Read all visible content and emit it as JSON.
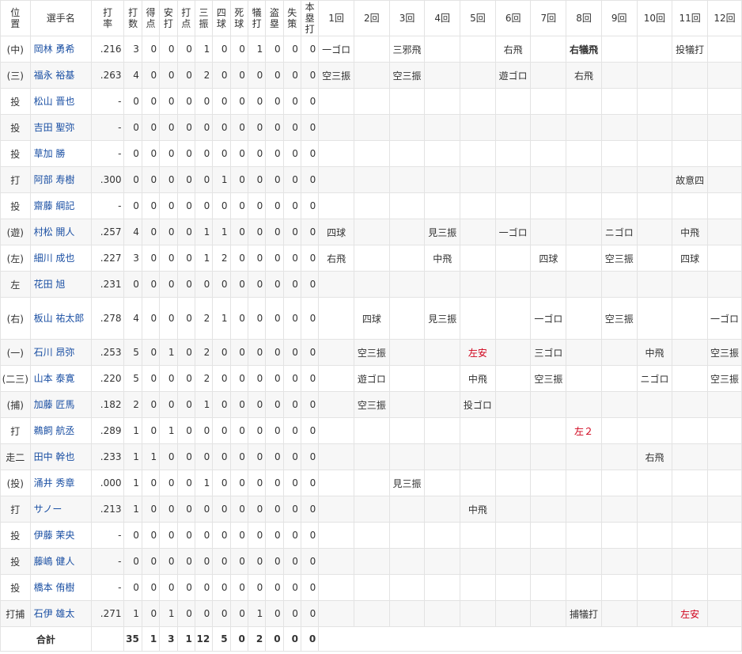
{
  "headers": {
    "pos": "位置",
    "name": "選手名",
    "avg": "打率",
    "ab": "打数",
    "r": "得点",
    "h": "安打",
    "rbi": "打点",
    "so": "三振",
    "bb": "四球",
    "hbp": "死球",
    "sac": "犠打",
    "sb": "盗塁",
    "e": "失策",
    "hr": "本塁打",
    "innings": [
      "1回",
      "2回",
      "3回",
      "4回",
      "5回",
      "6回",
      "7回",
      "8回",
      "9回",
      "10回",
      "11回",
      "12回"
    ]
  },
  "players": [
    {
      "pos": "(中)",
      "name": "岡林 勇希",
      "avg": ".216",
      "ab": "3",
      "r": "0",
      "h": "0",
      "rbi": "0",
      "so": "1",
      "bb": "0",
      "hbp": "0",
      "sac": "1",
      "sb": "0",
      "e": "0",
      "hr": "0",
      "inn": [
        "一ゴロ",
        "",
        "三邪飛",
        "",
        "",
        "右飛",
        "",
        "右犠飛",
        "",
        "",
        "投犠打",
        ""
      ],
      "red": [],
      "bold": [
        7
      ]
    },
    {
      "pos": "(三)",
      "name": "福永 裕基",
      "avg": ".263",
      "ab": "4",
      "r": "0",
      "h": "0",
      "rbi": "0",
      "so": "2",
      "bb": "0",
      "hbp": "0",
      "sac": "0",
      "sb": "0",
      "e": "0",
      "hr": "0",
      "inn": [
        "空三振",
        "",
        "空三振",
        "",
        "",
        "遊ゴロ",
        "",
        "右飛",
        "",
        "",
        "",
        ""
      ],
      "red": [],
      "bold": []
    },
    {
      "pos": "投",
      "name": "松山 晋也",
      "avg": "-",
      "ab": "0",
      "r": "0",
      "h": "0",
      "rbi": "0",
      "so": "0",
      "bb": "0",
      "hbp": "0",
      "sac": "0",
      "sb": "0",
      "e": "0",
      "hr": "0",
      "inn": [
        "",
        "",
        "",
        "",
        "",
        "",
        "",
        "",
        "",
        "",
        "",
        ""
      ],
      "red": [],
      "bold": []
    },
    {
      "pos": "投",
      "name": "吉田 聖弥",
      "avg": "-",
      "ab": "0",
      "r": "0",
      "h": "0",
      "rbi": "0",
      "so": "0",
      "bb": "0",
      "hbp": "0",
      "sac": "0",
      "sb": "0",
      "e": "0",
      "hr": "0",
      "inn": [
        "",
        "",
        "",
        "",
        "",
        "",
        "",
        "",
        "",
        "",
        "",
        ""
      ],
      "red": [],
      "bold": []
    },
    {
      "pos": "投",
      "name": "草加 勝",
      "avg": "-",
      "ab": "0",
      "r": "0",
      "h": "0",
      "rbi": "0",
      "so": "0",
      "bb": "0",
      "hbp": "0",
      "sac": "0",
      "sb": "0",
      "e": "0",
      "hr": "0",
      "inn": [
        "",
        "",
        "",
        "",
        "",
        "",
        "",
        "",
        "",
        "",
        "",
        ""
      ],
      "red": [],
      "bold": []
    },
    {
      "pos": "打",
      "name": "阿部 寿樹",
      "avg": ".300",
      "ab": "0",
      "r": "0",
      "h": "0",
      "rbi": "0",
      "so": "0",
      "bb": "1",
      "hbp": "0",
      "sac": "0",
      "sb": "0",
      "e": "0",
      "hr": "0",
      "inn": [
        "",
        "",
        "",
        "",
        "",
        "",
        "",
        "",
        "",
        "",
        "故意四",
        ""
      ],
      "red": [],
      "bold": []
    },
    {
      "pos": "投",
      "name": "齋藤 綱記",
      "avg": "-",
      "ab": "0",
      "r": "0",
      "h": "0",
      "rbi": "0",
      "so": "0",
      "bb": "0",
      "hbp": "0",
      "sac": "0",
      "sb": "0",
      "e": "0",
      "hr": "0",
      "inn": [
        "",
        "",
        "",
        "",
        "",
        "",
        "",
        "",
        "",
        "",
        "",
        ""
      ],
      "red": [],
      "bold": []
    },
    {
      "pos": "(遊)",
      "name": "村松 開人",
      "avg": ".257",
      "ab": "4",
      "r": "0",
      "h": "0",
      "rbi": "0",
      "so": "1",
      "bb": "1",
      "hbp": "0",
      "sac": "0",
      "sb": "0",
      "e": "0",
      "hr": "0",
      "inn": [
        "四球",
        "",
        "",
        "見三振",
        "",
        "一ゴロ",
        "",
        "",
        "ニゴロ",
        "",
        "中飛",
        ""
      ],
      "red": [],
      "bold": []
    },
    {
      "pos": "(左)",
      "name": "細川 成也",
      "avg": ".227",
      "ab": "3",
      "r": "0",
      "h": "0",
      "rbi": "0",
      "so": "1",
      "bb": "2",
      "hbp": "0",
      "sac": "0",
      "sb": "0",
      "e": "0",
      "hr": "0",
      "inn": [
        "右飛",
        "",
        "",
        "中飛",
        "",
        "",
        "四球",
        "",
        "空三振",
        "",
        "四球",
        ""
      ],
      "red": [],
      "bold": []
    },
    {
      "pos": "左",
      "name": "花田 旭",
      "avg": ".231",
      "ab": "0",
      "r": "0",
      "h": "0",
      "rbi": "0",
      "so": "0",
      "bb": "0",
      "hbp": "0",
      "sac": "0",
      "sb": "0",
      "e": "0",
      "hr": "0",
      "inn": [
        "",
        "",
        "",
        "",
        "",
        "",
        "",
        "",
        "",
        "",
        "",
        ""
      ],
      "red": [],
      "bold": []
    },
    {
      "pos": "(右)",
      "name": "板山 祐太郎",
      "avg": ".278",
      "ab": "4",
      "r": "0",
      "h": "0",
      "rbi": "0",
      "so": "2",
      "bb": "1",
      "hbp": "0",
      "sac": "0",
      "sb": "0",
      "e": "0",
      "hr": "0",
      "inn": [
        "",
        "四球",
        "",
        "見三振",
        "",
        "",
        "一ゴロ",
        "",
        "空三振",
        "",
        "",
        "一ゴロ"
      ],
      "red": [],
      "bold": [],
      "tall": true
    },
    {
      "pos": "(一)",
      "name": "石川 昂弥",
      "avg": ".253",
      "ab": "5",
      "r": "0",
      "h": "1",
      "rbi": "0",
      "so": "2",
      "bb": "0",
      "hbp": "0",
      "sac": "0",
      "sb": "0",
      "e": "0",
      "hr": "0",
      "inn": [
        "",
        "空三振",
        "",
        "",
        "左安",
        "",
        "三ゴロ",
        "",
        "",
        "中飛",
        "",
        "空三振"
      ],
      "red": [
        4
      ],
      "bold": []
    },
    {
      "pos": "(二三)",
      "name": "山本 泰寛",
      "avg": ".220",
      "ab": "5",
      "r": "0",
      "h": "0",
      "rbi": "0",
      "so": "2",
      "bb": "0",
      "hbp": "0",
      "sac": "0",
      "sb": "0",
      "e": "0",
      "hr": "0",
      "inn": [
        "",
        "遊ゴロ",
        "",
        "",
        "中飛",
        "",
        "空三振",
        "",
        "",
        "ニゴロ",
        "",
        "空三振"
      ],
      "red": [],
      "bold": []
    },
    {
      "pos": "(捕)",
      "name": "加藤 匠馬",
      "avg": ".182",
      "ab": "2",
      "r": "0",
      "h": "0",
      "rbi": "0",
      "so": "1",
      "bb": "0",
      "hbp": "0",
      "sac": "0",
      "sb": "0",
      "e": "0",
      "hr": "0",
      "inn": [
        "",
        "空三振",
        "",
        "",
        "投ゴロ",
        "",
        "",
        "",
        "",
        "",
        "",
        ""
      ],
      "red": [],
      "bold": []
    },
    {
      "pos": "打",
      "name": "鵜飼 航丞",
      "avg": ".289",
      "ab": "1",
      "r": "0",
      "h": "1",
      "rbi": "0",
      "so": "0",
      "bb": "0",
      "hbp": "0",
      "sac": "0",
      "sb": "0",
      "e": "0",
      "hr": "0",
      "inn": [
        "",
        "",
        "",
        "",
        "",
        "",
        "",
        "左２",
        "",
        "",
        "",
        ""
      ],
      "red": [
        7
      ],
      "bold": []
    },
    {
      "pos": "走二",
      "name": "田中 幹也",
      "avg": ".233",
      "ab": "1",
      "r": "1",
      "h": "0",
      "rbi": "0",
      "so": "0",
      "bb": "0",
      "hbp": "0",
      "sac": "0",
      "sb": "0",
      "e": "0",
      "hr": "0",
      "inn": [
        "",
        "",
        "",
        "",
        "",
        "",
        "",
        "",
        "",
        "右飛",
        "",
        ""
      ],
      "red": [],
      "bold": []
    },
    {
      "pos": "(投)",
      "name": "涌井 秀章",
      "avg": ".000",
      "ab": "1",
      "r": "0",
      "h": "0",
      "rbi": "0",
      "so": "1",
      "bb": "0",
      "hbp": "0",
      "sac": "0",
      "sb": "0",
      "e": "0",
      "hr": "0",
      "inn": [
        "",
        "",
        "見三振",
        "",
        "",
        "",
        "",
        "",
        "",
        "",
        "",
        ""
      ],
      "red": [],
      "bold": []
    },
    {
      "pos": "打",
      "name": "サノー",
      "avg": ".213",
      "ab": "1",
      "r": "0",
      "h": "0",
      "rbi": "0",
      "so": "0",
      "bb": "0",
      "hbp": "0",
      "sac": "0",
      "sb": "0",
      "e": "0",
      "hr": "0",
      "inn": [
        "",
        "",
        "",
        "",
        "中飛",
        "",
        "",
        "",
        "",
        "",
        "",
        ""
      ],
      "red": [],
      "bold": []
    },
    {
      "pos": "投",
      "name": "伊藤 茉央",
      "avg": "-",
      "ab": "0",
      "r": "0",
      "h": "0",
      "rbi": "0",
      "so": "0",
      "bb": "0",
      "hbp": "0",
      "sac": "0",
      "sb": "0",
      "e": "0",
      "hr": "0",
      "inn": [
        "",
        "",
        "",
        "",
        "",
        "",
        "",
        "",
        "",
        "",
        "",
        ""
      ],
      "red": [],
      "bold": []
    },
    {
      "pos": "投",
      "name": "藤嶋 健人",
      "avg": "-",
      "ab": "0",
      "r": "0",
      "h": "0",
      "rbi": "0",
      "so": "0",
      "bb": "0",
      "hbp": "0",
      "sac": "0",
      "sb": "0",
      "e": "0",
      "hr": "0",
      "inn": [
        "",
        "",
        "",
        "",
        "",
        "",
        "",
        "",
        "",
        "",
        "",
        ""
      ],
      "red": [],
      "bold": []
    },
    {
      "pos": "投",
      "name": "橋本 侑樹",
      "avg": "-",
      "ab": "0",
      "r": "0",
      "h": "0",
      "rbi": "0",
      "so": "0",
      "bb": "0",
      "hbp": "0",
      "sac": "0",
      "sb": "0",
      "e": "0",
      "hr": "0",
      "inn": [
        "",
        "",
        "",
        "",
        "",
        "",
        "",
        "",
        "",
        "",
        "",
        ""
      ],
      "red": [],
      "bold": []
    },
    {
      "pos": "打捕",
      "name": "石伊 雄太",
      "avg": ".271",
      "ab": "1",
      "r": "0",
      "h": "1",
      "rbi": "0",
      "so": "0",
      "bb": "0",
      "hbp": "0",
      "sac": "1",
      "sb": "0",
      "e": "0",
      "hr": "0",
      "inn": [
        "",
        "",
        "",
        "",
        "",
        "",
        "",
        "捕犠打",
        "",
        "",
        "左安",
        ""
      ],
      "red": [
        10
      ],
      "bold": []
    }
  ],
  "totals": {
    "label": "合計",
    "ab": "35",
    "r": "1",
    "h": "3",
    "rbi": "1",
    "so": "12",
    "bb": "5",
    "hbp": "0",
    "sac": "2",
    "sb": "0",
    "e": "0",
    "hr": "0"
  }
}
